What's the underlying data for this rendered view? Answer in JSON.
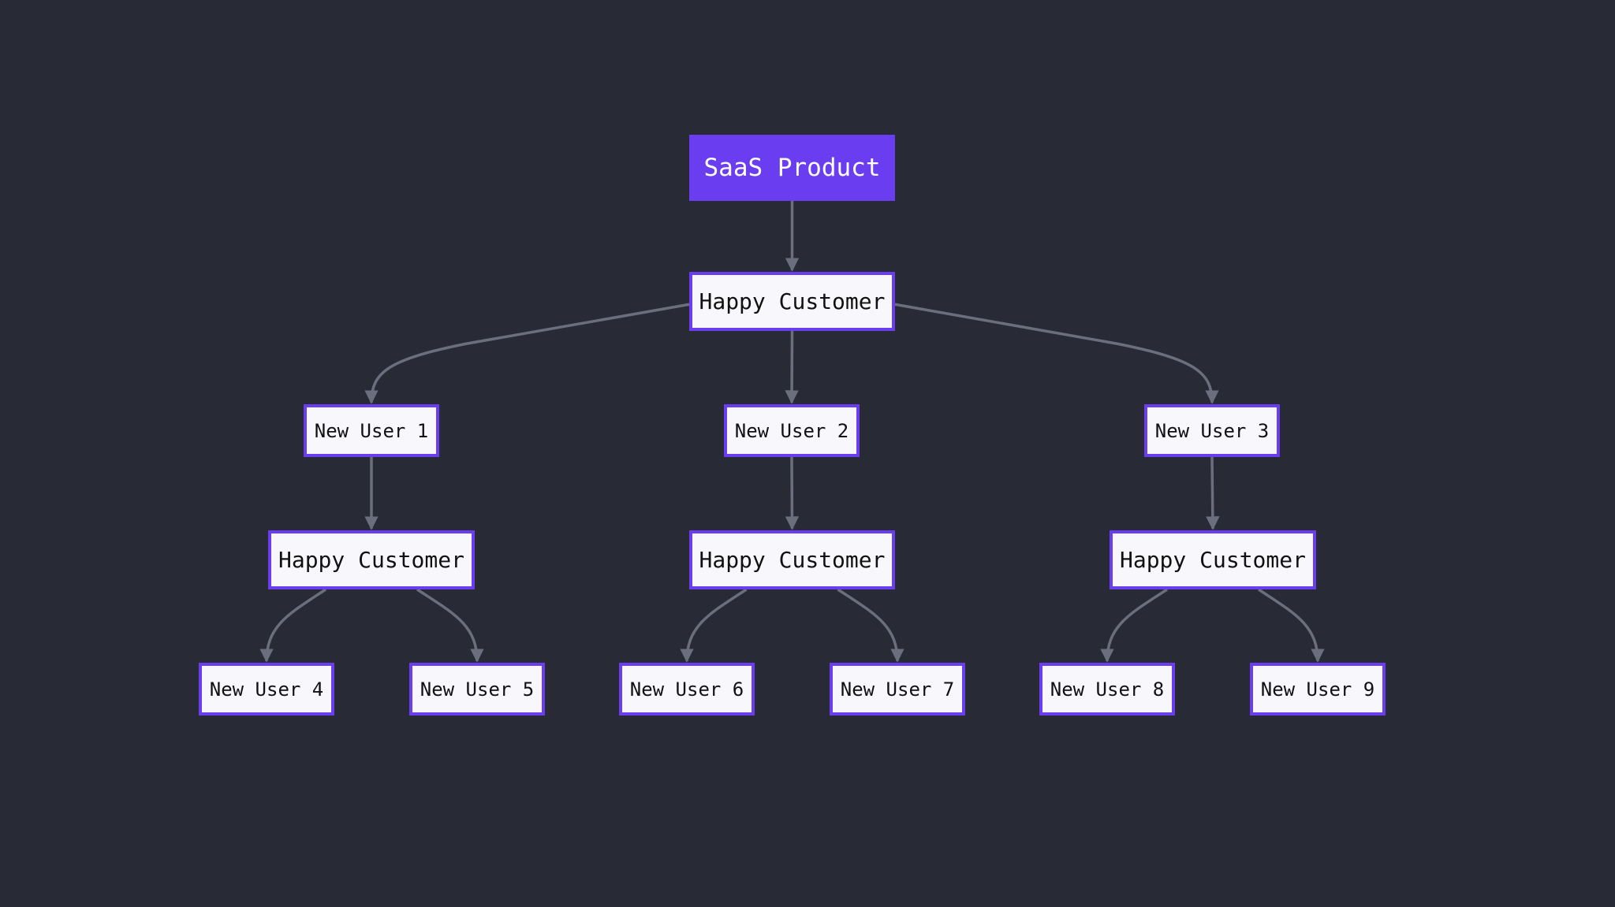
{
  "colors": {
    "background": "#282a35",
    "accent": "#6b3df0",
    "node_fill": "#f8f7fc",
    "edge": "#6b6f7d"
  },
  "nodes": [
    {
      "id": "saas",
      "label": "SaaS Product",
      "kind": "root"
    },
    {
      "id": "hc0",
      "label": "Happy Customer",
      "kind": "happy"
    },
    {
      "id": "nu1",
      "label": "New User 1",
      "kind": "user"
    },
    {
      "id": "nu2",
      "label": "New User 2",
      "kind": "user"
    },
    {
      "id": "nu3",
      "label": "New User 3",
      "kind": "user"
    },
    {
      "id": "hc1",
      "label": "Happy Customer",
      "kind": "happy"
    },
    {
      "id": "hc2",
      "label": "Happy Customer",
      "kind": "happy"
    },
    {
      "id": "hc3",
      "label": "Happy Customer",
      "kind": "happy"
    },
    {
      "id": "nu4",
      "label": "New User 4",
      "kind": "user"
    },
    {
      "id": "nu5",
      "label": "New User 5",
      "kind": "user"
    },
    {
      "id": "nu6",
      "label": "New User 6",
      "kind": "user"
    },
    {
      "id": "nu7",
      "label": "New User 7",
      "kind": "user"
    },
    {
      "id": "nu8",
      "label": "New User 8",
      "kind": "user"
    },
    {
      "id": "nu9",
      "label": "New User 9",
      "kind": "user"
    }
  ],
  "edges": [
    {
      "from": "saas",
      "to": "hc0"
    },
    {
      "from": "hc0",
      "to": "nu1"
    },
    {
      "from": "hc0",
      "to": "nu2"
    },
    {
      "from": "hc0",
      "to": "nu3"
    },
    {
      "from": "nu1",
      "to": "hc1"
    },
    {
      "from": "nu2",
      "to": "hc2"
    },
    {
      "from": "nu3",
      "to": "hc3"
    },
    {
      "from": "hc1",
      "to": "nu4"
    },
    {
      "from": "hc1",
      "to": "nu5"
    },
    {
      "from": "hc2",
      "to": "nu6"
    },
    {
      "from": "hc2",
      "to": "nu7"
    },
    {
      "from": "hc3",
      "to": "nu8"
    },
    {
      "from": "hc3",
      "to": "nu9"
    }
  ]
}
